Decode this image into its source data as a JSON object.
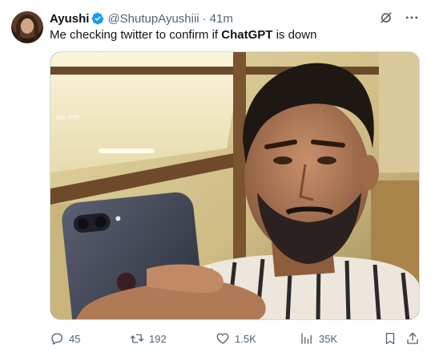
{
  "tweet": {
    "author_name": "Ayushi",
    "author_handle": "@ShutupAyushiii",
    "separator": "·",
    "time_ago": "41m",
    "text_before": "Me checking twitter to confirm if ",
    "text_bold": "ChatGPT",
    "text_after": " is down"
  },
  "media": {
    "watermark": "स्टार गोल्ड"
  },
  "actions": {
    "replies": "45",
    "retweets": "192",
    "likes": "1.5K",
    "views": "35K"
  },
  "icons": {
    "verified": "verified-badge-icon",
    "grok": "grok-icon",
    "more": "more-icon",
    "reply": "reply-icon",
    "retweet": "retweet-icon",
    "like": "heart-icon",
    "views": "views-icon",
    "bookmark": "bookmark-icon",
    "share": "share-icon"
  },
  "colors": {
    "text": "#0f1419",
    "secondary": "#536471",
    "verified": "#1d9bf0"
  }
}
